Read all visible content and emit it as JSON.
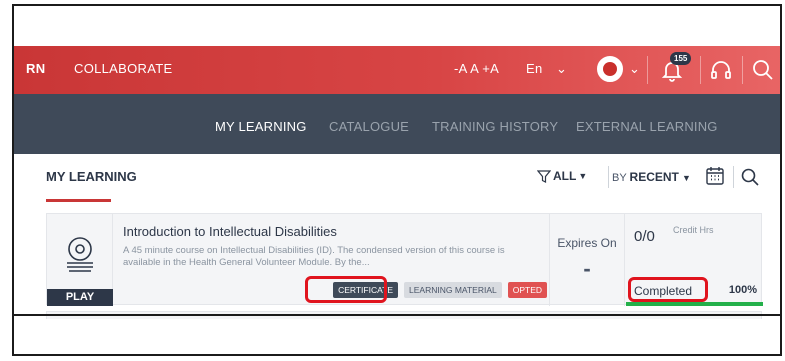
{
  "topbar": {
    "learn_partial": "RN",
    "collaborate": "COLLABORATE",
    "font_sizes": "-A  A  +A",
    "language": "En",
    "notification_count": "155",
    "icons": [
      "chevron-down-icon",
      "avatar-icon",
      "bell-icon",
      "headset-icon",
      "search-icon"
    ]
  },
  "nav": {
    "tabs": [
      {
        "label": "MY LEARNING",
        "active": true
      },
      {
        "label": "CATALOGUE",
        "active": false
      },
      {
        "label": "TRAINING HISTORY",
        "active": false
      },
      {
        "label": "EXTERNAL LEARNING",
        "active": false
      }
    ]
  },
  "section": {
    "title": "MY LEARNING",
    "filter_label": "ALL",
    "sort_prefix": "BY",
    "sort_value": "RECENT"
  },
  "course": {
    "play_label": "PLAY",
    "title": "Introduction to Intellectual Disabilities",
    "description": "A 45 minute course on Intellectual Disabilities (ID). The condensed version of this course is available in the Health General Volunteer Module. By the...",
    "tags": [
      "CERTIFICATE",
      "LEARNING MATERIAL",
      "OPTED"
    ],
    "expires_label": "Expires On",
    "expires_value": "-",
    "credits_value": "0/0",
    "credits_label": "Credit Hrs",
    "status": "Completed",
    "progress_text": "100%",
    "progress_fraction": 1.0
  },
  "colors": {
    "brand_red": "#c93636",
    "nav_dark": "#3f4a59",
    "progress_green": "#24b04a",
    "annotation_red": "#e0141e"
  }
}
